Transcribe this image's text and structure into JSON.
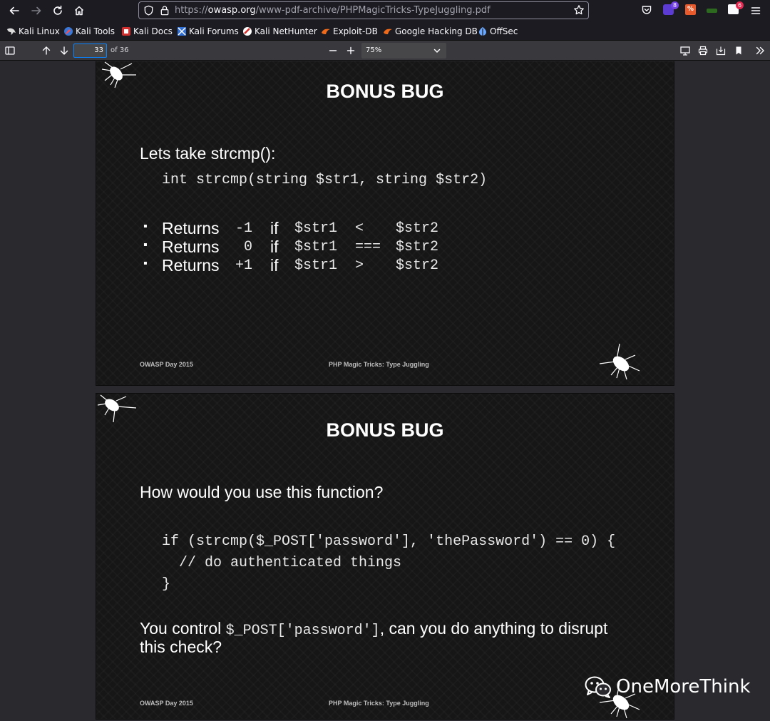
{
  "browser": {
    "url_prefix": "https://",
    "url_domain": "owasp.org",
    "url_path": "/www-pdf-archive/PHPMagicTricks-TypeJuggling.pdf",
    "extensions": [
      {
        "name": "ublock-extension-icon",
        "badge": "8",
        "badge_color": "#7542e5"
      },
      {
        "name": "web-extension-icon",
        "badge": ""
      },
      {
        "name": "tab-extension-icon",
        "badge": ""
      },
      {
        "name": "mail-extension-icon",
        "badge": "6",
        "badge_color": "#e22850"
      }
    ]
  },
  "bookmarks": [
    {
      "label": "Kali Linux",
      "icon": "kali-dragon-icon"
    },
    {
      "label": "Kali Tools",
      "icon": "kali-tools-icon"
    },
    {
      "label": "Kali Docs",
      "icon": "kali-docs-icon"
    },
    {
      "label": "Kali Forums",
      "icon": "kali-forums-icon"
    },
    {
      "label": "Kali NetHunter",
      "icon": "nethunter-icon"
    },
    {
      "label": "Exploit-DB",
      "icon": "exploit-db-icon"
    },
    {
      "label": "Google Hacking DB",
      "icon": "ghdb-icon"
    },
    {
      "label": "OffSec",
      "icon": "offsec-icon"
    }
  ],
  "pdf_toolbar": {
    "page_number": "33",
    "page_count": "of 36",
    "zoom": "75%"
  },
  "slides": [
    {
      "title": "BONUS BUG",
      "intro": "Lets take strcmp():",
      "signature": "int strcmp(string $str1, string $str2)",
      "bullets": [
        {
          "word": "Returns",
          "value": "-1",
          "cond": "if",
          "lhs": "$str1",
          "op": "<",
          "rhs": "$str2"
        },
        {
          "word": "Returns",
          "value": " 0",
          "cond": "if",
          "lhs": "$str1",
          "op": "===",
          "rhs": "$str2"
        },
        {
          "word": "Returns",
          "value": "+1",
          "cond": "if",
          "lhs": "$str1",
          "op": ">",
          "rhs": "$str2"
        }
      ],
      "footer_left": "OWASP Day 2015",
      "footer_center": "PHP Magic Tricks: Type Juggling"
    },
    {
      "title": "BONUS BUG",
      "question": "How would you use this function?",
      "code": [
        "if (strcmp($_POST['password'], 'thePassword') == 0) {",
        "  // do authenticated things",
        "}"
      ],
      "control_pre": "You control",
      "control_code": "$_POST['password']",
      "control_post": ", can you do anything to disrupt",
      "control_line2": "this check?",
      "footer_left": "OWASP Day 2015",
      "footer_center": "PHP Magic Tricks: Type Juggling"
    }
  ],
  "watermark": {
    "text": "OneMoreThink",
    "icon": "wechat-icon"
  }
}
